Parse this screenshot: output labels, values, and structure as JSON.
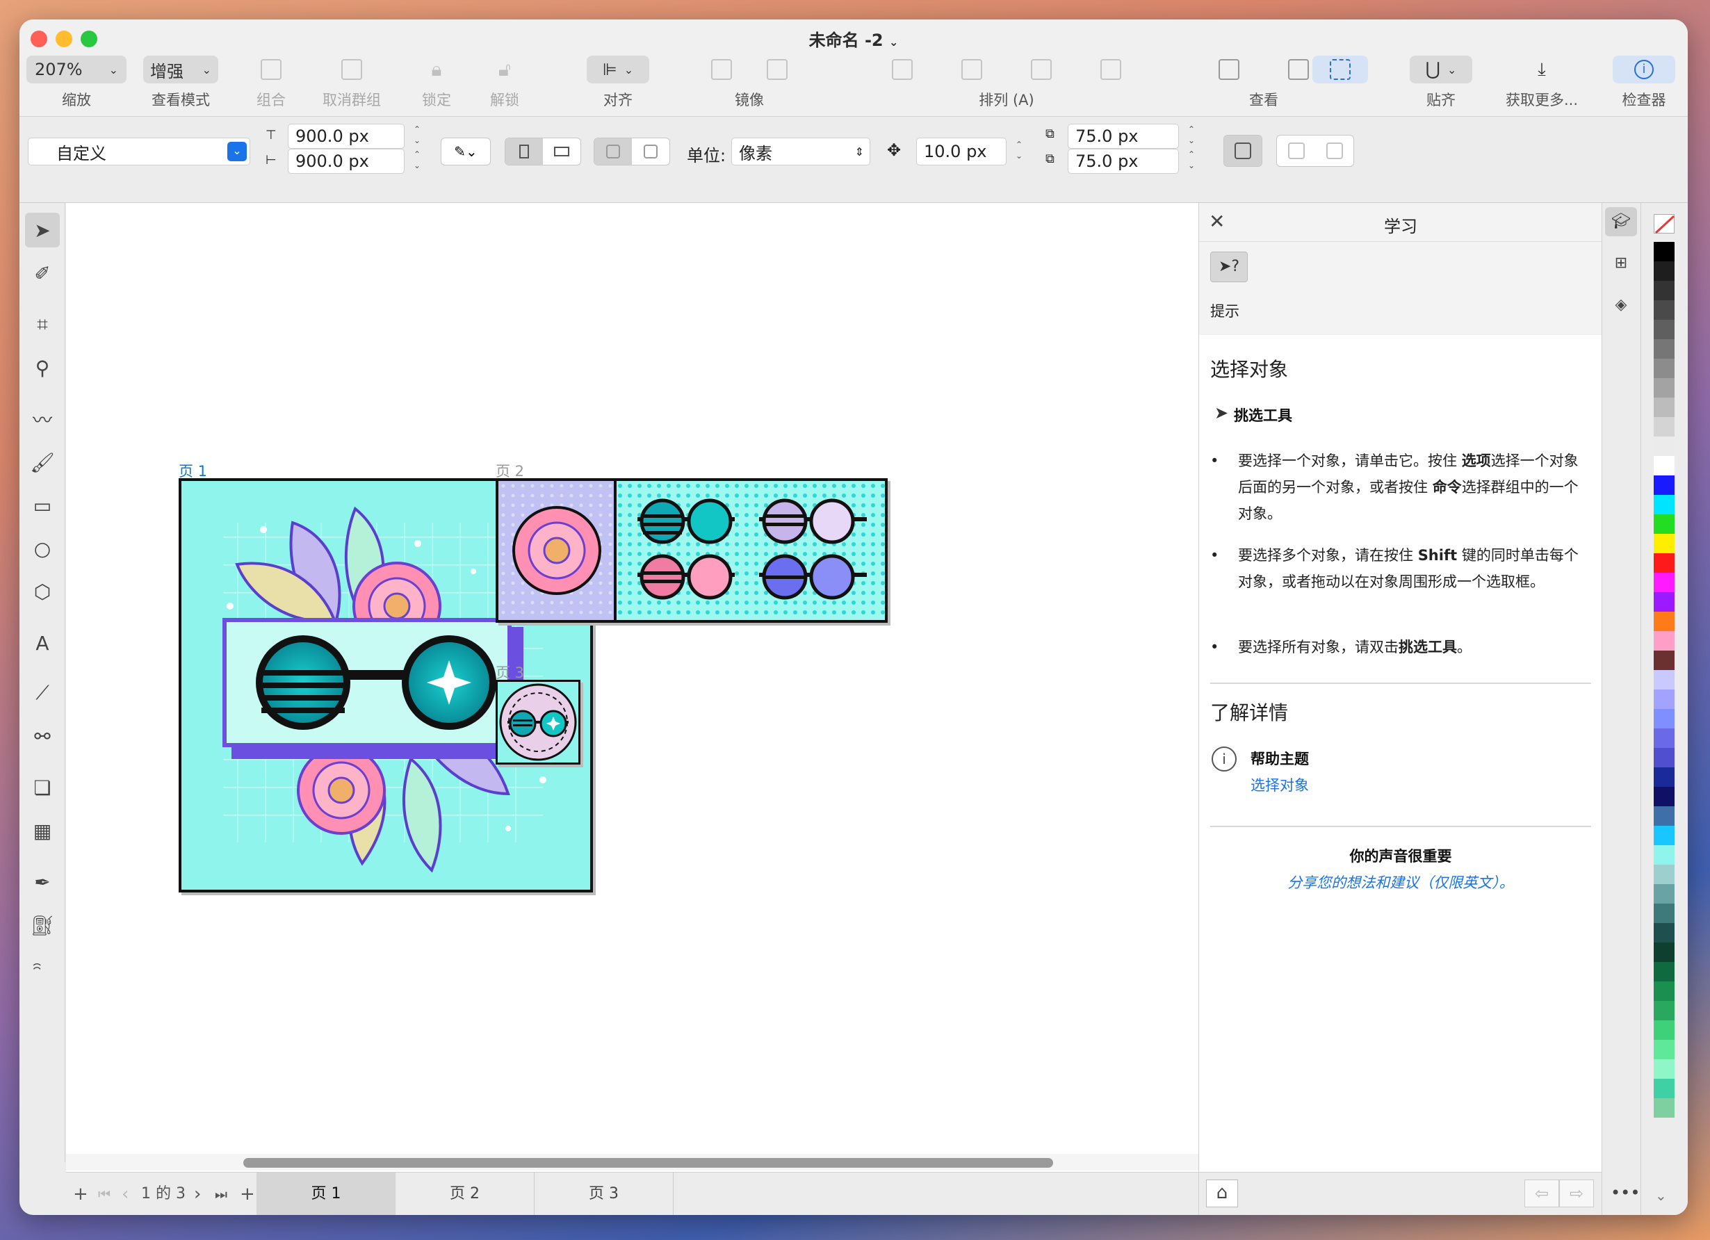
{
  "window": {
    "title": "未命名 -2"
  },
  "toolbar": {
    "zoom_value": "207%",
    "zoom_label": "缩放",
    "view_mode_value": "增强",
    "view_mode_label": "查看模式",
    "group_label": "组合",
    "ungroup_label": "取消群组",
    "lock_label": "锁定",
    "unlock_label": "解锁",
    "align_label": "对齐",
    "mirror_label": "镜像",
    "arrange_label": "排列 (A)",
    "view_label": "查看",
    "snap_label": "贴齐",
    "get_more_label": "获取更多...",
    "inspector_label": "检查器"
  },
  "propbar": {
    "preset_value": "自定义",
    "width_value": "900.0 px",
    "height_value": "900.0 px",
    "unit_label": "单位:",
    "unit_value": "像素",
    "nudge_value": "10.0 px",
    "dup_x_value": "75.0 px",
    "dup_y_value": "75.0 px"
  },
  "pages": [
    {
      "label": "页 1"
    },
    {
      "label": "页 2"
    },
    {
      "label": "页 3"
    }
  ],
  "pagebar": {
    "counter": "1 的 3",
    "tabs": [
      "页 1",
      "页 2",
      "页 3"
    ]
  },
  "learn": {
    "title": "学习",
    "hint_label": "提示",
    "section_title": "选择对象",
    "tool_name": "挑选工具",
    "bullets": [
      [
        "要选择一个对象，请单击它。按住",
        "选项",
        "选择一个对象后面的另一个对象，或者按住",
        "命令",
        "选择群组中的一个对象。"
      ],
      [
        "要选择多个对象，请在按住",
        "Shift",
        "键的同时单击每个对象，或者拖动以在对象周围形成一个选取框。"
      ],
      [
        "要选择所有对象，请双击",
        "挑选工具",
        "。"
      ]
    ],
    "learn_more_title": "了解详情",
    "help_topic_label": "帮助主题",
    "help_link": "选择对象",
    "feedback_title": "你的声音很重要",
    "feedback_link": "分享您的想法和建议（仅限英文）。"
  },
  "colors": {
    "accent": "#1a73e8",
    "page_label_active": "#0a7bd3",
    "art_bg": "#8ff5ec"
  }
}
